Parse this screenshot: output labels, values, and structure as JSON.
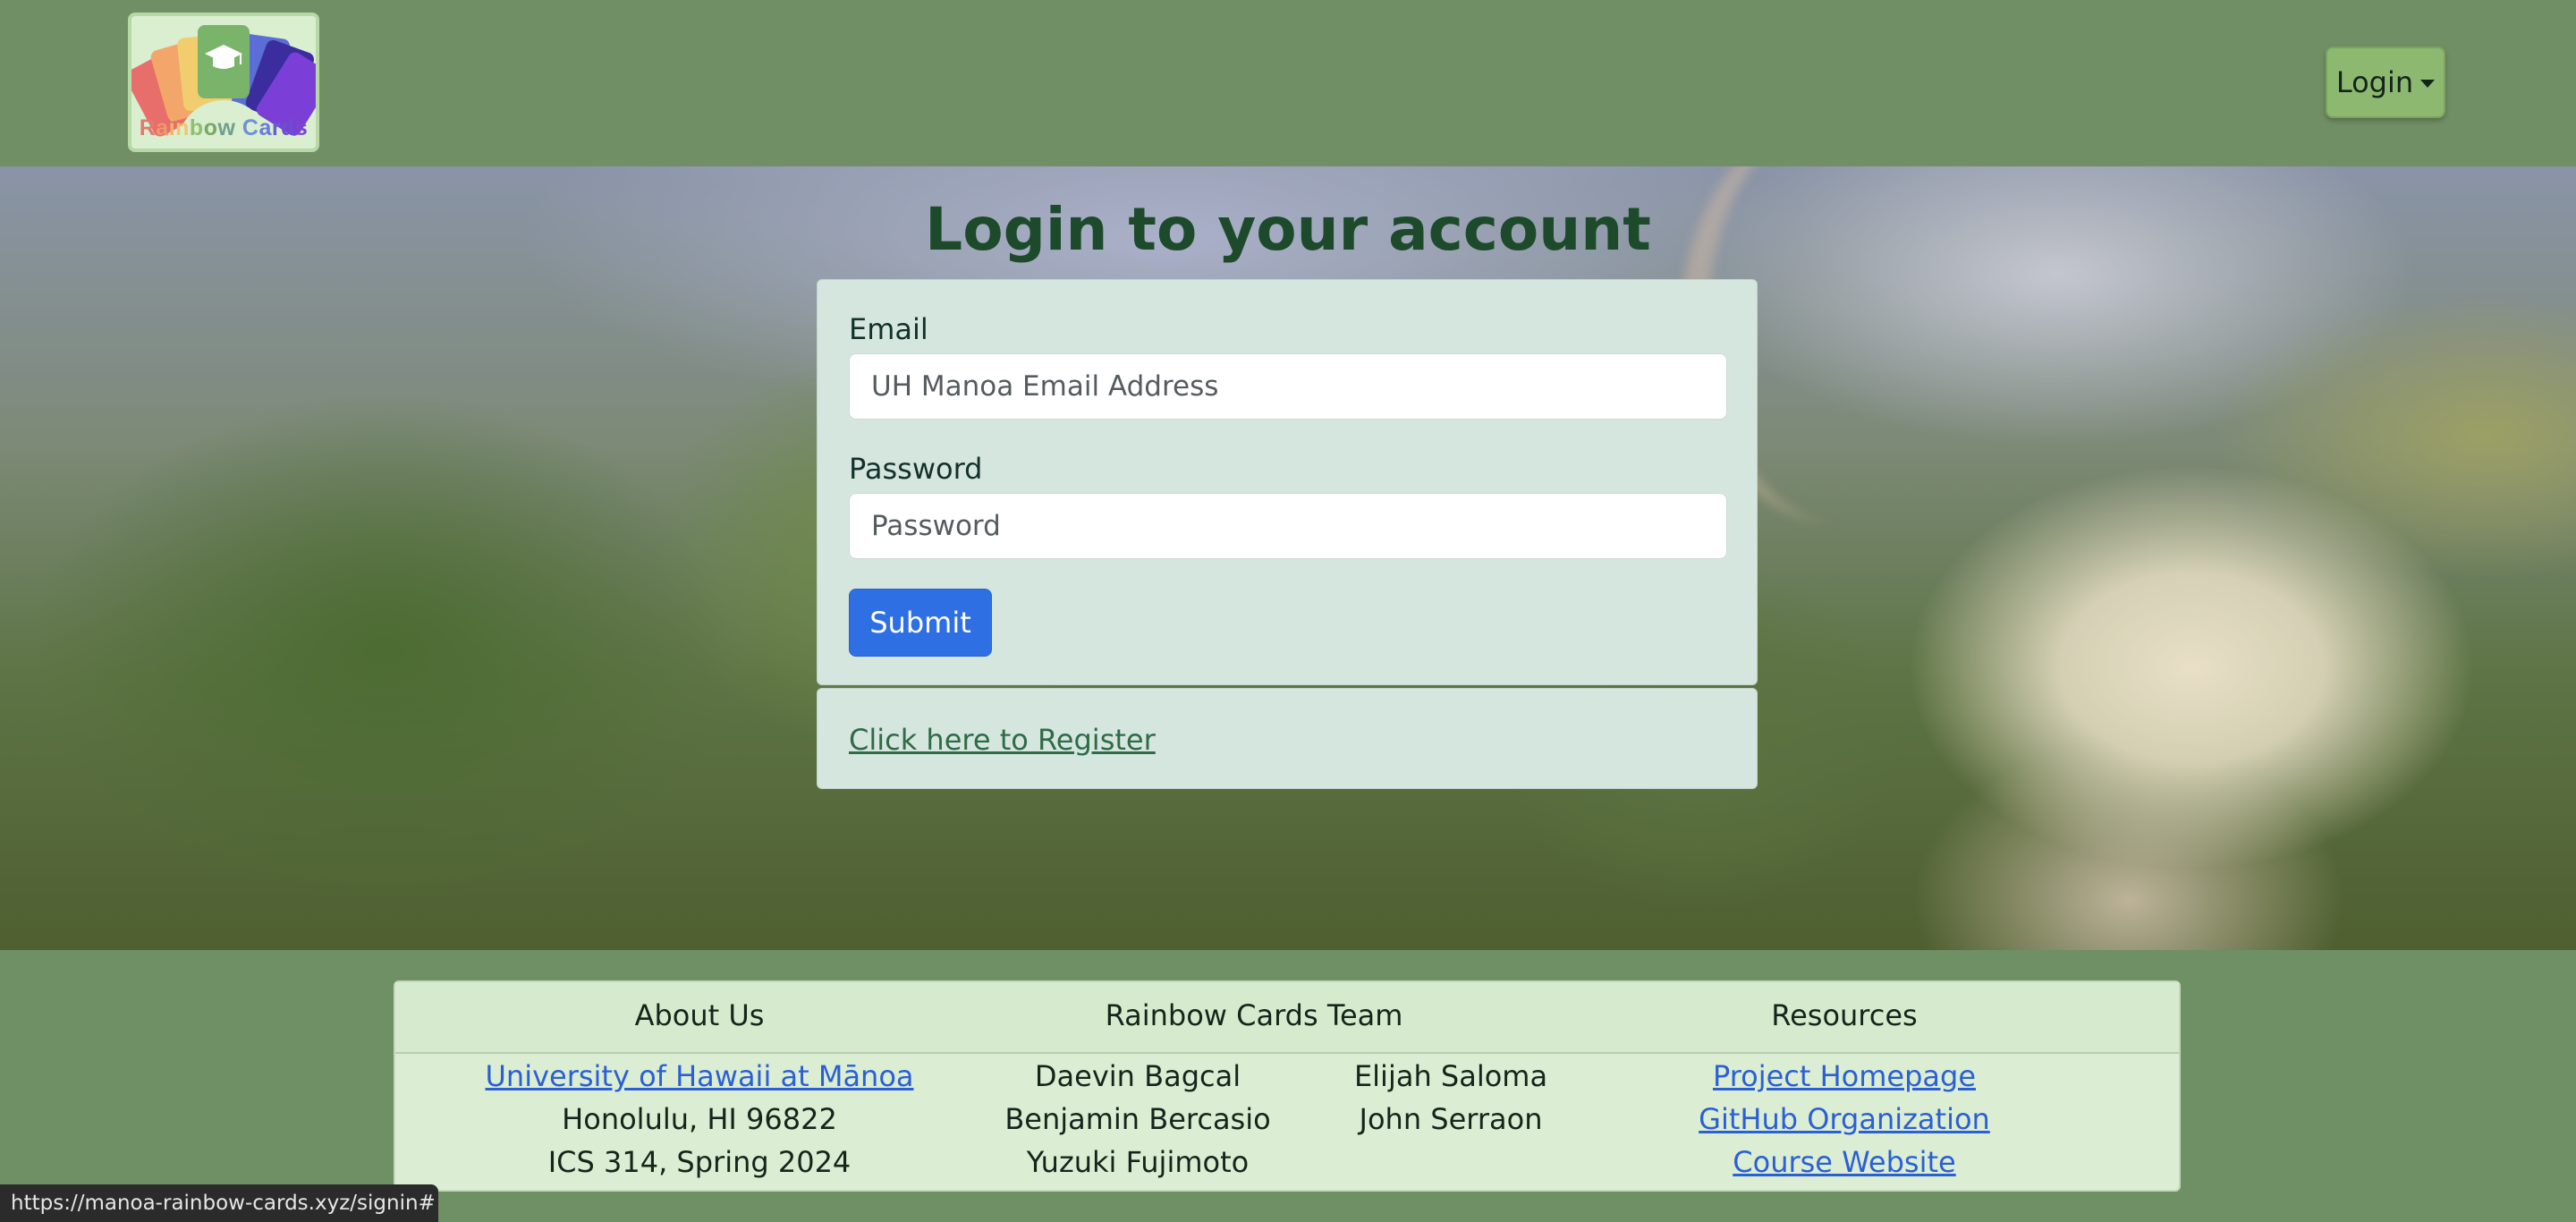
{
  "navbar": {
    "logo_text_chars": [
      {
        "ch": "R",
        "color": "#e07a6c"
      },
      {
        "ch": "a",
        "color": "#ea9a6b"
      },
      {
        "ch": "i",
        "color": "#f0b36d"
      },
      {
        "ch": "n",
        "color": "#ecc86e"
      },
      {
        "ch": "b",
        "color": "#8fbf6f"
      },
      {
        "ch": "o",
        "color": "#79a766"
      },
      {
        "ch": "w",
        "color": "#6fa08f"
      },
      {
        "ch": " ",
        "color": "#6fa08f"
      },
      {
        "ch": "C",
        "color": "#6f8fd8"
      },
      {
        "ch": "a",
        "color": "#6a7ad8"
      },
      {
        "ch": "r",
        "color": "#6b5cd4"
      },
      {
        "ch": "d",
        "color": "#6a4fd0"
      },
      {
        "ch": "s",
        "color": "#7a45cc"
      }
    ],
    "login_label": "Login"
  },
  "main": {
    "title": "Login to your account",
    "email": {
      "label": "Email",
      "placeholder": "UH Manoa Email Address",
      "value": ""
    },
    "password": {
      "label": "Password",
      "placeholder": "Password",
      "value": ""
    },
    "submit_label": "Submit",
    "register_link": "Click here to Register"
  },
  "footer": {
    "about": {
      "title": "About Us",
      "link": "University of Hawaii at Mānoa",
      "address": "Honolulu, HI 96822",
      "course": "ICS 314, Spring 2024"
    },
    "team": {
      "title": "Rainbow Cards Team",
      "col1": [
        "Daevin Bagcal",
        "Benjamin Bercasio",
        "Yuzuki Fujimoto"
      ],
      "col2": [
        "Elijah Saloma",
        "John Serraon"
      ]
    },
    "resources": {
      "title": "Resources",
      "links": [
        "Project Homepage",
        "GitHub Organization",
        "Course Website"
      ]
    }
  },
  "status_bar": {
    "url": "https://manoa-rainbow-cards.xyz/signin#"
  },
  "colors": {
    "navbar": "#718f65",
    "login_button": "#8cb870",
    "card": "#d5e6df",
    "submit": "#2f6fe4",
    "footer_card": "#dbeed3",
    "link_blue": "#2b5fd6"
  }
}
